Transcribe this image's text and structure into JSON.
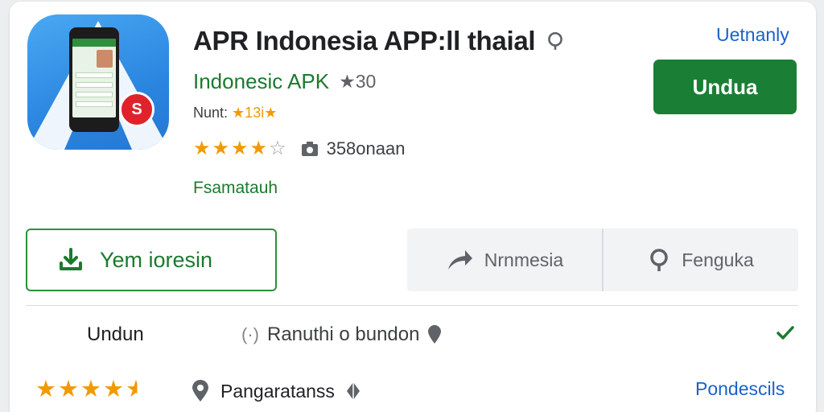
{
  "app": {
    "title": "APR Indonesia APP:ll thaial",
    "subtitle": "Indonesic APK",
    "rating_note": "★30",
    "dev_prefix": "Nunt:",
    "dev_stars_note": "★13i★",
    "stars_filled": 4,
    "stars_total": 5,
    "downloads": "358onaan",
    "category": "Fsamatauh",
    "badge_glyph": "S"
  },
  "header": {
    "top_link": "Uetnanly",
    "install_label": "Undua"
  },
  "actions": {
    "primary_label": "Yem ioresin",
    "secondary": [
      {
        "label": "Nrnmesia",
        "icon": "share-arrow-icon"
      },
      {
        "label": "Fenguka",
        "icon": "location-pin-icon"
      }
    ]
  },
  "info": {
    "row1_label": "Undun",
    "row1_paren": "(·)",
    "row1_text": "Ranuthi o bundon",
    "row2_rating": 4.5,
    "row2_text": "Pangaratanss",
    "row2_link": "Pondescils"
  },
  "colors": {
    "green": "#1a7f34",
    "blue_link": "#1a62c8",
    "star": "#f29900"
  }
}
